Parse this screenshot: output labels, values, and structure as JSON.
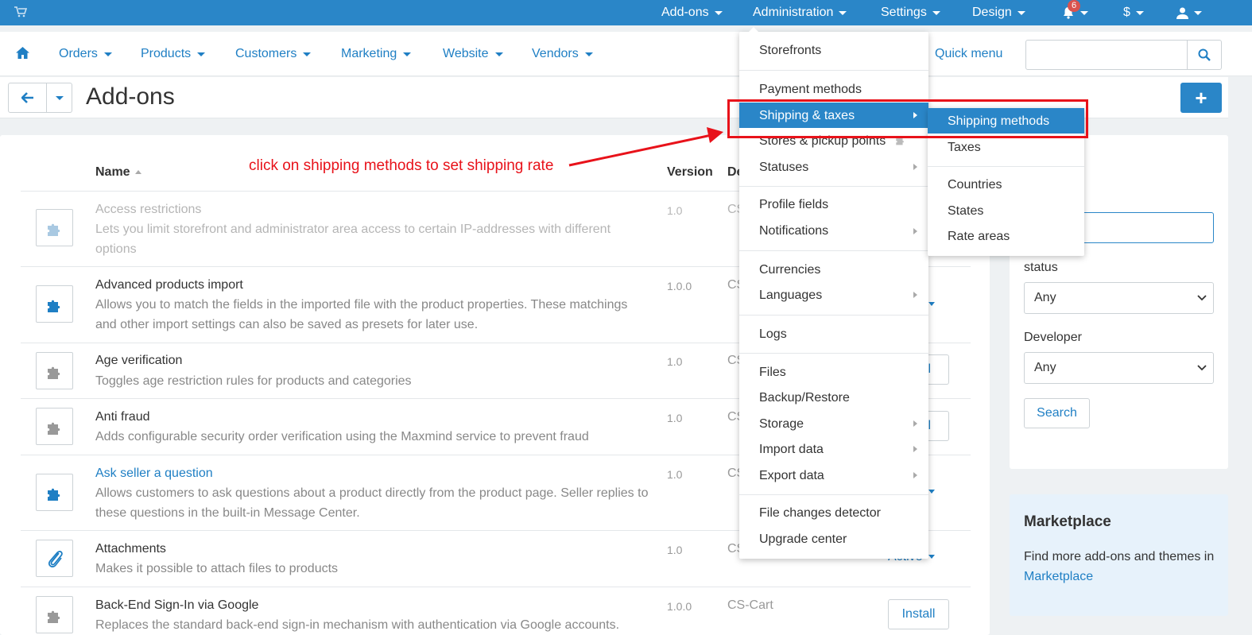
{
  "topbar": {
    "addons": "Add-ons",
    "administration": "Administration",
    "settings": "Settings",
    "design": "Design",
    "notifications_count": "6",
    "currency": "$"
  },
  "subnav": {
    "orders": "Orders",
    "products": "Products",
    "customers": "Customers",
    "marketing": "Marketing",
    "website": "Website",
    "vendors": "Vendors",
    "quick_menu": "Quick menu"
  },
  "page": {
    "title": "Add-ons"
  },
  "table": {
    "headers": {
      "name": "Name",
      "version": "Version",
      "developer_partial": "De"
    },
    "rows": [
      {
        "name": "Access restrictions",
        "desc": "Lets you limit storefront and administrator area access to certain IP-addresses with different options",
        "version": "1.0",
        "dev": "CS"
      },
      {
        "name": "Advanced products import",
        "desc": "Allows you to match the fields in the imported file with the product properties. These matchings and other import settings can also be saved as presets for later use.",
        "version": "1.0.0",
        "dev": "CS"
      },
      {
        "name": "Age verification",
        "desc": "Toggles age restriction rules for products and categories",
        "version": "1.0",
        "dev": "CS"
      },
      {
        "name": "Anti fraud",
        "desc": "Adds configurable security order verification using the Maxmind service to prevent fraud",
        "version": "1.0",
        "dev": "CS"
      },
      {
        "name": "Ask seller a question",
        "desc": "Allows customers to ask questions about a product directly from the product page. Seller replies to these questions in the built-in Message Center.",
        "version": "1.0",
        "dev": "CS"
      },
      {
        "name": "Attachments",
        "desc": "Makes it possible to attach files to products",
        "version": "1.0",
        "dev": "CS"
      },
      {
        "name": "Back-End Sign-In via Google",
        "desc": "Replaces the standard back-end sign-in mechanism with authentication via Google accounts.",
        "version": "1.0.0",
        "dev": "CS-Cart"
      }
    ],
    "partial_install_1": "ll",
    "partial_install_2": "ll",
    "partial_status": "Active",
    "install_label": "Install"
  },
  "sidebar": {
    "status_label": "status",
    "status_value": "Any",
    "developer_label": "Developer",
    "developer_value": "Any",
    "search_button": "Search"
  },
  "marketplace": {
    "title": "Marketplace",
    "text": "Find more add-ons and themes in ",
    "link": "Marketplace"
  },
  "admin_menu": {
    "items": [
      "Storefronts",
      "Payment methods",
      "Shipping & taxes",
      "Stores & pickup points",
      "Statuses",
      "Profile fields",
      "Notifications",
      "Currencies",
      "Languages",
      "Logs",
      "Files",
      "Backup/Restore",
      "Storage",
      "Import data",
      "Export data",
      "File changes detector",
      "Upgrade center"
    ]
  },
  "submenu": {
    "items": [
      "Shipping methods",
      "Taxes",
      "Countries",
      "States",
      "Rate areas"
    ]
  },
  "annotation": {
    "text": "click on shipping methods to set shipping rate"
  },
  "colors": {
    "brand": "#2a86c8",
    "link": "#1f7fc4",
    "annotation": "#e8121a"
  }
}
